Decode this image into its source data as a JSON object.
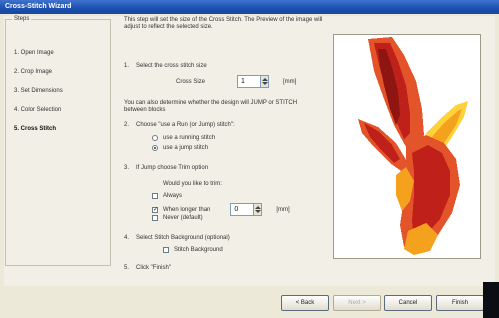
{
  "window": {
    "title": "Cross-Stitch Wizard"
  },
  "steps": {
    "legend": "Steps",
    "items": [
      {
        "label": "1. Open Image"
      },
      {
        "label": "2. Crop Image"
      },
      {
        "label": "3. Set Dimensions"
      },
      {
        "label": "4. Color Selection"
      },
      {
        "label": "5. Cross Stitch",
        "active": true
      }
    ]
  },
  "intro": "This step will set the size of the Cross Stitch. The Preview of the image will adjust to reflect the selected size.",
  "step1": {
    "number": "1.",
    "text": "Select the cross stitch size",
    "field_label": "Cross Size",
    "value": "1",
    "unit": "[mm]"
  },
  "hint": "You can also determine whether the design will JUMP or STITCH between blocks",
  "step2": {
    "number": "2.",
    "text": "Choose \"use a Run (or Jump) stitch\":",
    "options": [
      {
        "label": "use a running stitch",
        "checked": false
      },
      {
        "label": "use a jump stitch",
        "checked": true
      }
    ]
  },
  "step3": {
    "number": "3.",
    "text": "If Jump choose Trim option",
    "question": "Would you like to trim:",
    "options": [
      {
        "label": "Always",
        "checked": false
      },
      {
        "label": "When longer than",
        "checked": true
      },
      {
        "label": "Never (default)",
        "checked": false
      }
    ],
    "value": "0",
    "unit": "[mm]"
  },
  "step4": {
    "number": "4.",
    "text": "Select Stitch Background (optional)",
    "checkbox_label": "Stitch Background",
    "checked": false
  },
  "step5": {
    "number": "5.",
    "text": "Click \"Finish\""
  },
  "buttons": {
    "back": "< Back",
    "next": "Next >",
    "cancel": "Cancel",
    "finish": "Finish"
  },
  "colors": {
    "title_bar": "#1b4fb0",
    "flame_dark": "#c0201a",
    "flame_mid": "#e3542a",
    "flame_light": "#f4a11e",
    "flame_yellow": "#ffd23a"
  }
}
